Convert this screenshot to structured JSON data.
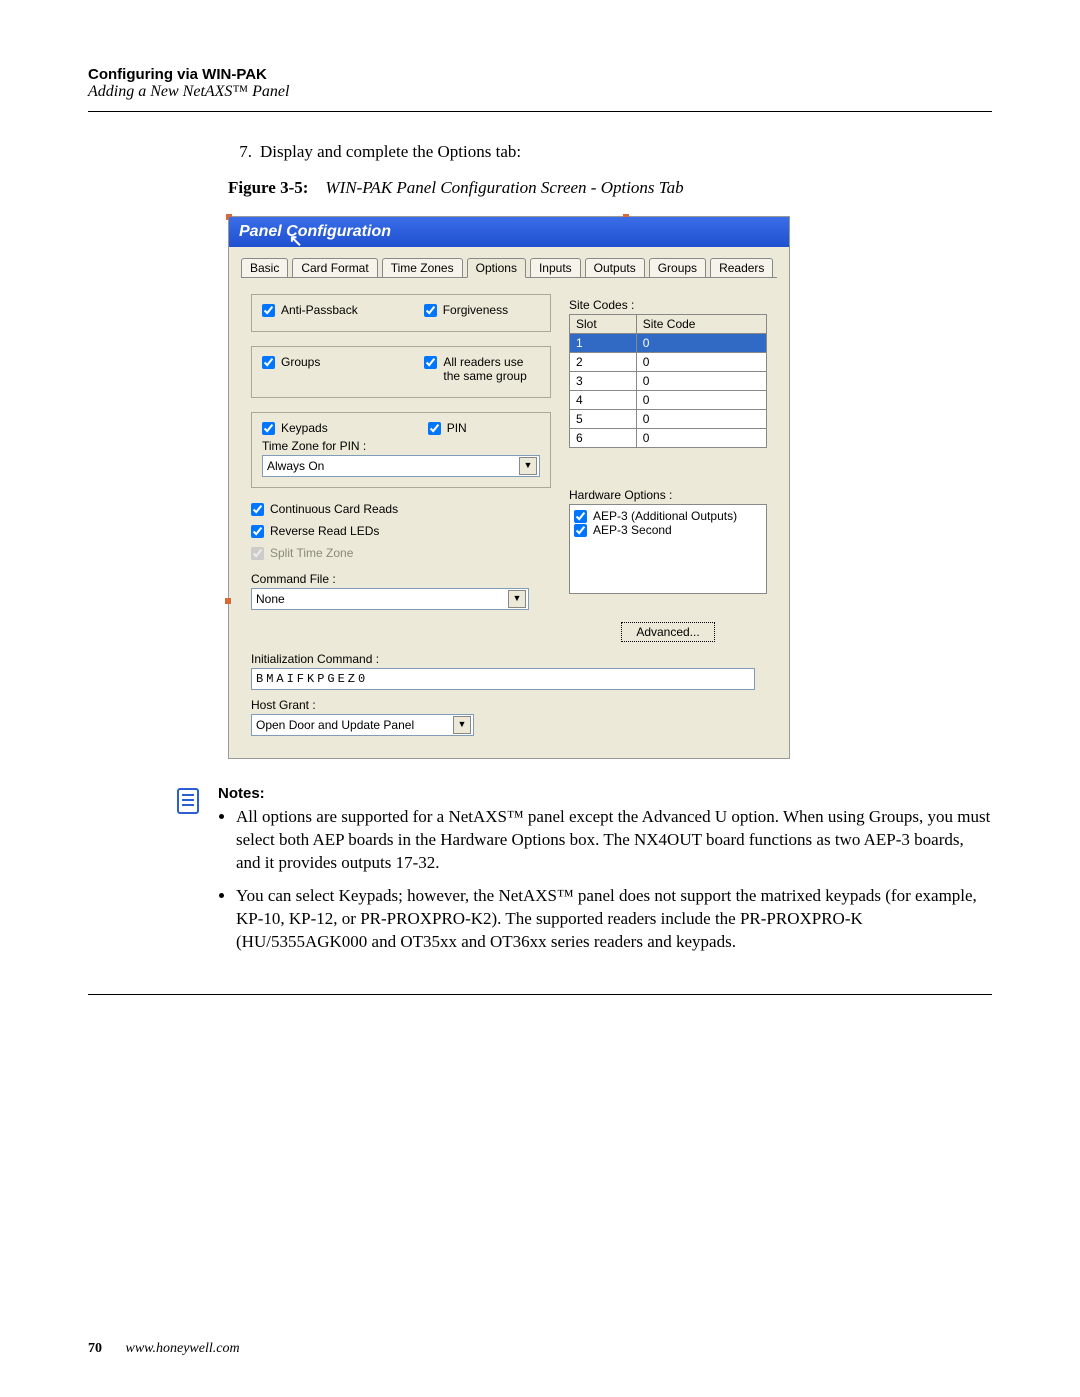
{
  "header": {
    "section": "Configuring via WIN-PAK",
    "subsection": "Adding a New NetAXS™ Panel"
  },
  "step": {
    "number": "7.",
    "text": "Display and complete the Options tab:"
  },
  "figure": {
    "label": "Figure 3-5:",
    "title": "WIN-PAK Panel Configuration Screen - Options Tab"
  },
  "dialog": {
    "title": "Panel Configuration",
    "tabs": [
      "Basic",
      "Card Format",
      "Time Zones",
      "Options",
      "Inputs",
      "Outputs",
      "Groups",
      "Readers"
    ],
    "active_tab": 3,
    "options": {
      "anti_passback": "Anti-Passback",
      "forgiveness": "Forgiveness",
      "groups": "Groups",
      "all_readers": "All readers use the same group",
      "keypads": "Keypads",
      "pin": "PIN",
      "tz_pin_label": "Time Zone for PIN :",
      "tz_pin_value": "Always On",
      "continuous": "Continuous Card Reads",
      "reverse": "Reverse Read LEDs",
      "split": "Split Time Zone",
      "cmdfile_label": "Command File :",
      "cmdfile_value": "None",
      "initcmd_label": "Initialization Command :",
      "initcmd_value": "BMAIFKPGEZ0",
      "hostgrant_label": "Host Grant :",
      "hostgrant_value": "Open Door and Update Panel",
      "sitecodes_label": "Site Codes :",
      "sitecodes_headers": {
        "slot": "Slot",
        "code": "Site Code"
      },
      "sitecodes": [
        {
          "slot": "1",
          "code": "0",
          "selected": true
        },
        {
          "slot": "2",
          "code": "0"
        },
        {
          "slot": "3",
          "code": "0"
        },
        {
          "slot": "4",
          "code": "0"
        },
        {
          "slot": "5",
          "code": "0"
        },
        {
          "slot": "6",
          "code": "0"
        }
      ],
      "hw_label": "Hardware Options :",
      "hw_items": [
        "AEP-3 (Additional Outputs)",
        "AEP-3 Second"
      ],
      "advanced": "Advanced..."
    }
  },
  "notes": {
    "heading": "Notes:",
    "items": [
      "All options are supported for a NetAXS™ panel except the Advanced U option. When using Groups, you must select both AEP boards in the Hardware Options box. The NX4OUT board functions as two AEP-3 boards, and it provides outputs 17-32.",
      "You can select Keypads; however, the NetAXS™ panel does not support the matrixed keypads (for example, KP-10, KP-12, or PR-PROXPRO-K2). The supported readers include the PR-PROXPRO-K (HU/5355AGK000 and OT35xx and OT36xx series readers and keypads."
    ]
  },
  "footer": {
    "page": "70",
    "url": "www.honeywell.com"
  }
}
